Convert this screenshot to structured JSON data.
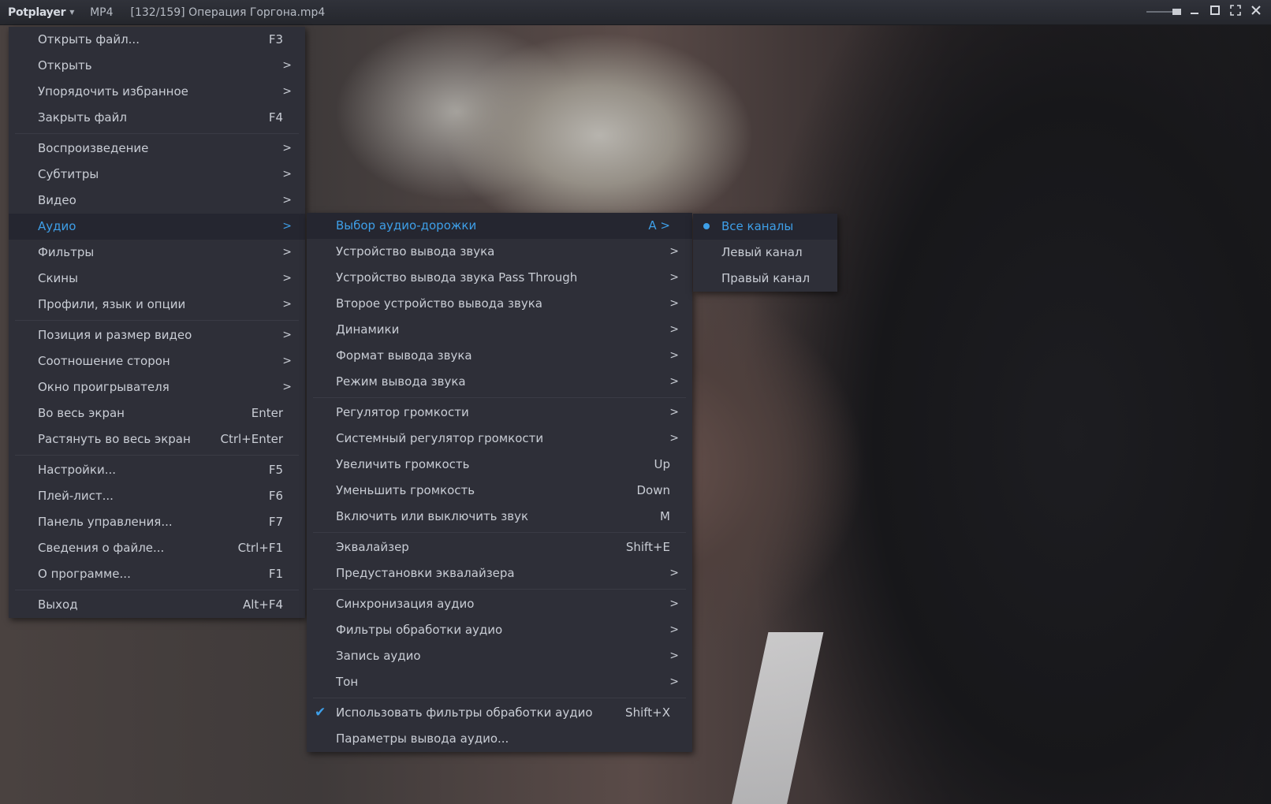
{
  "window": {
    "brand": "Potplayer",
    "format": "MP4",
    "file_title": "[132/159] Операция Горгона.mp4",
    "controls": [
      "minimize-icon",
      "maximize-icon",
      "fullscreen-icon",
      "close-icon"
    ]
  },
  "colors": {
    "accent": "#3e9fe8",
    "menu_bg": "#2e2f38",
    "active_bg": "#252630",
    "text": "#c9cdd5"
  },
  "main_menu": {
    "groups": [
      [
        {
          "label": "Открыть файл...",
          "shortcut": "F3"
        },
        {
          "label": "Открыть",
          "arrow": ">"
        },
        {
          "label": "Упорядочить избранное",
          "arrow": ">"
        },
        {
          "label": "Закрыть файл",
          "shortcut": "F4"
        }
      ],
      [
        {
          "label": "Воспроизведение",
          "arrow": ">"
        },
        {
          "label": "Субтитры",
          "arrow": ">"
        },
        {
          "label": "Видео",
          "arrow": ">"
        },
        {
          "label": "Аудио",
          "arrow": ">",
          "active": true
        },
        {
          "label": "Фильтры",
          "arrow": ">"
        },
        {
          "label": "Скины",
          "arrow": ">"
        },
        {
          "label": "Профили, язык и опции",
          "arrow": ">"
        }
      ],
      [
        {
          "label": "Позиция и размер видео",
          "arrow": ">"
        },
        {
          "label": "Соотношение сторон",
          "arrow": ">"
        },
        {
          "label": "Окно проигрывателя",
          "arrow": ">"
        },
        {
          "label": "Во весь экран",
          "shortcut": "Enter"
        },
        {
          "label": "Растянуть во весь экран",
          "shortcut": "Ctrl+Enter"
        }
      ],
      [
        {
          "label": "Настройки...",
          "shortcut": "F5"
        },
        {
          "label": "Плей-лист...",
          "shortcut": "F6"
        },
        {
          "label": "Панель управления...",
          "shortcut": "F7"
        },
        {
          "label": "Сведения о файле...",
          "shortcut": "Ctrl+F1"
        },
        {
          "label": "О программе...",
          "shortcut": "F1"
        }
      ],
      [
        {
          "label": "Выход",
          "shortcut": "Alt+F4"
        }
      ]
    ]
  },
  "audio_menu": {
    "groups": [
      [
        {
          "label": "Выбор аудио-дорожки",
          "shortcut": "A >",
          "active": true
        },
        {
          "label": "Устройство вывода звука",
          "arrow": ">"
        },
        {
          "label": "Устройство вывода звука Pass Through",
          "arrow": ">"
        },
        {
          "label": "Второе устройство вывода звука",
          "arrow": ">"
        },
        {
          "label": "Динамики",
          "arrow": ">"
        },
        {
          "label": "Формат вывода звука",
          "arrow": ">"
        },
        {
          "label": "Режим вывода звука",
          "arrow": ">"
        }
      ],
      [
        {
          "label": "Регулятор громкости",
          "arrow": ">"
        },
        {
          "label": "Системный регулятор громкости",
          "arrow": ">"
        },
        {
          "label": "Увеличить громкость",
          "shortcut": "Up"
        },
        {
          "label": "Уменьшить громкость",
          "shortcut": "Down"
        },
        {
          "label": "Включить или выключить звук",
          "shortcut": "M"
        }
      ],
      [
        {
          "label": "Эквалайзер",
          "shortcut": "Shift+E"
        },
        {
          "label": "Предустановки эквалайзера",
          "arrow": ">"
        }
      ],
      [
        {
          "label": "Синхронизация аудио",
          "arrow": ">"
        },
        {
          "label": "Фильтры обработки аудио",
          "arrow": ">"
        },
        {
          "label": "Запись аудио",
          "arrow": ">"
        },
        {
          "label": "Тон",
          "arrow": ">"
        }
      ],
      [
        {
          "label": "Использовать фильтры обработки аудио",
          "shortcut": "Shift+X",
          "checked": true
        },
        {
          "label": "Параметры вывода аудио..."
        }
      ]
    ]
  },
  "channel_menu": {
    "items": [
      {
        "label": "Все каналы",
        "selected": true,
        "active": true
      },
      {
        "label": "Левый канал"
      },
      {
        "label": "Правый канал"
      }
    ]
  }
}
